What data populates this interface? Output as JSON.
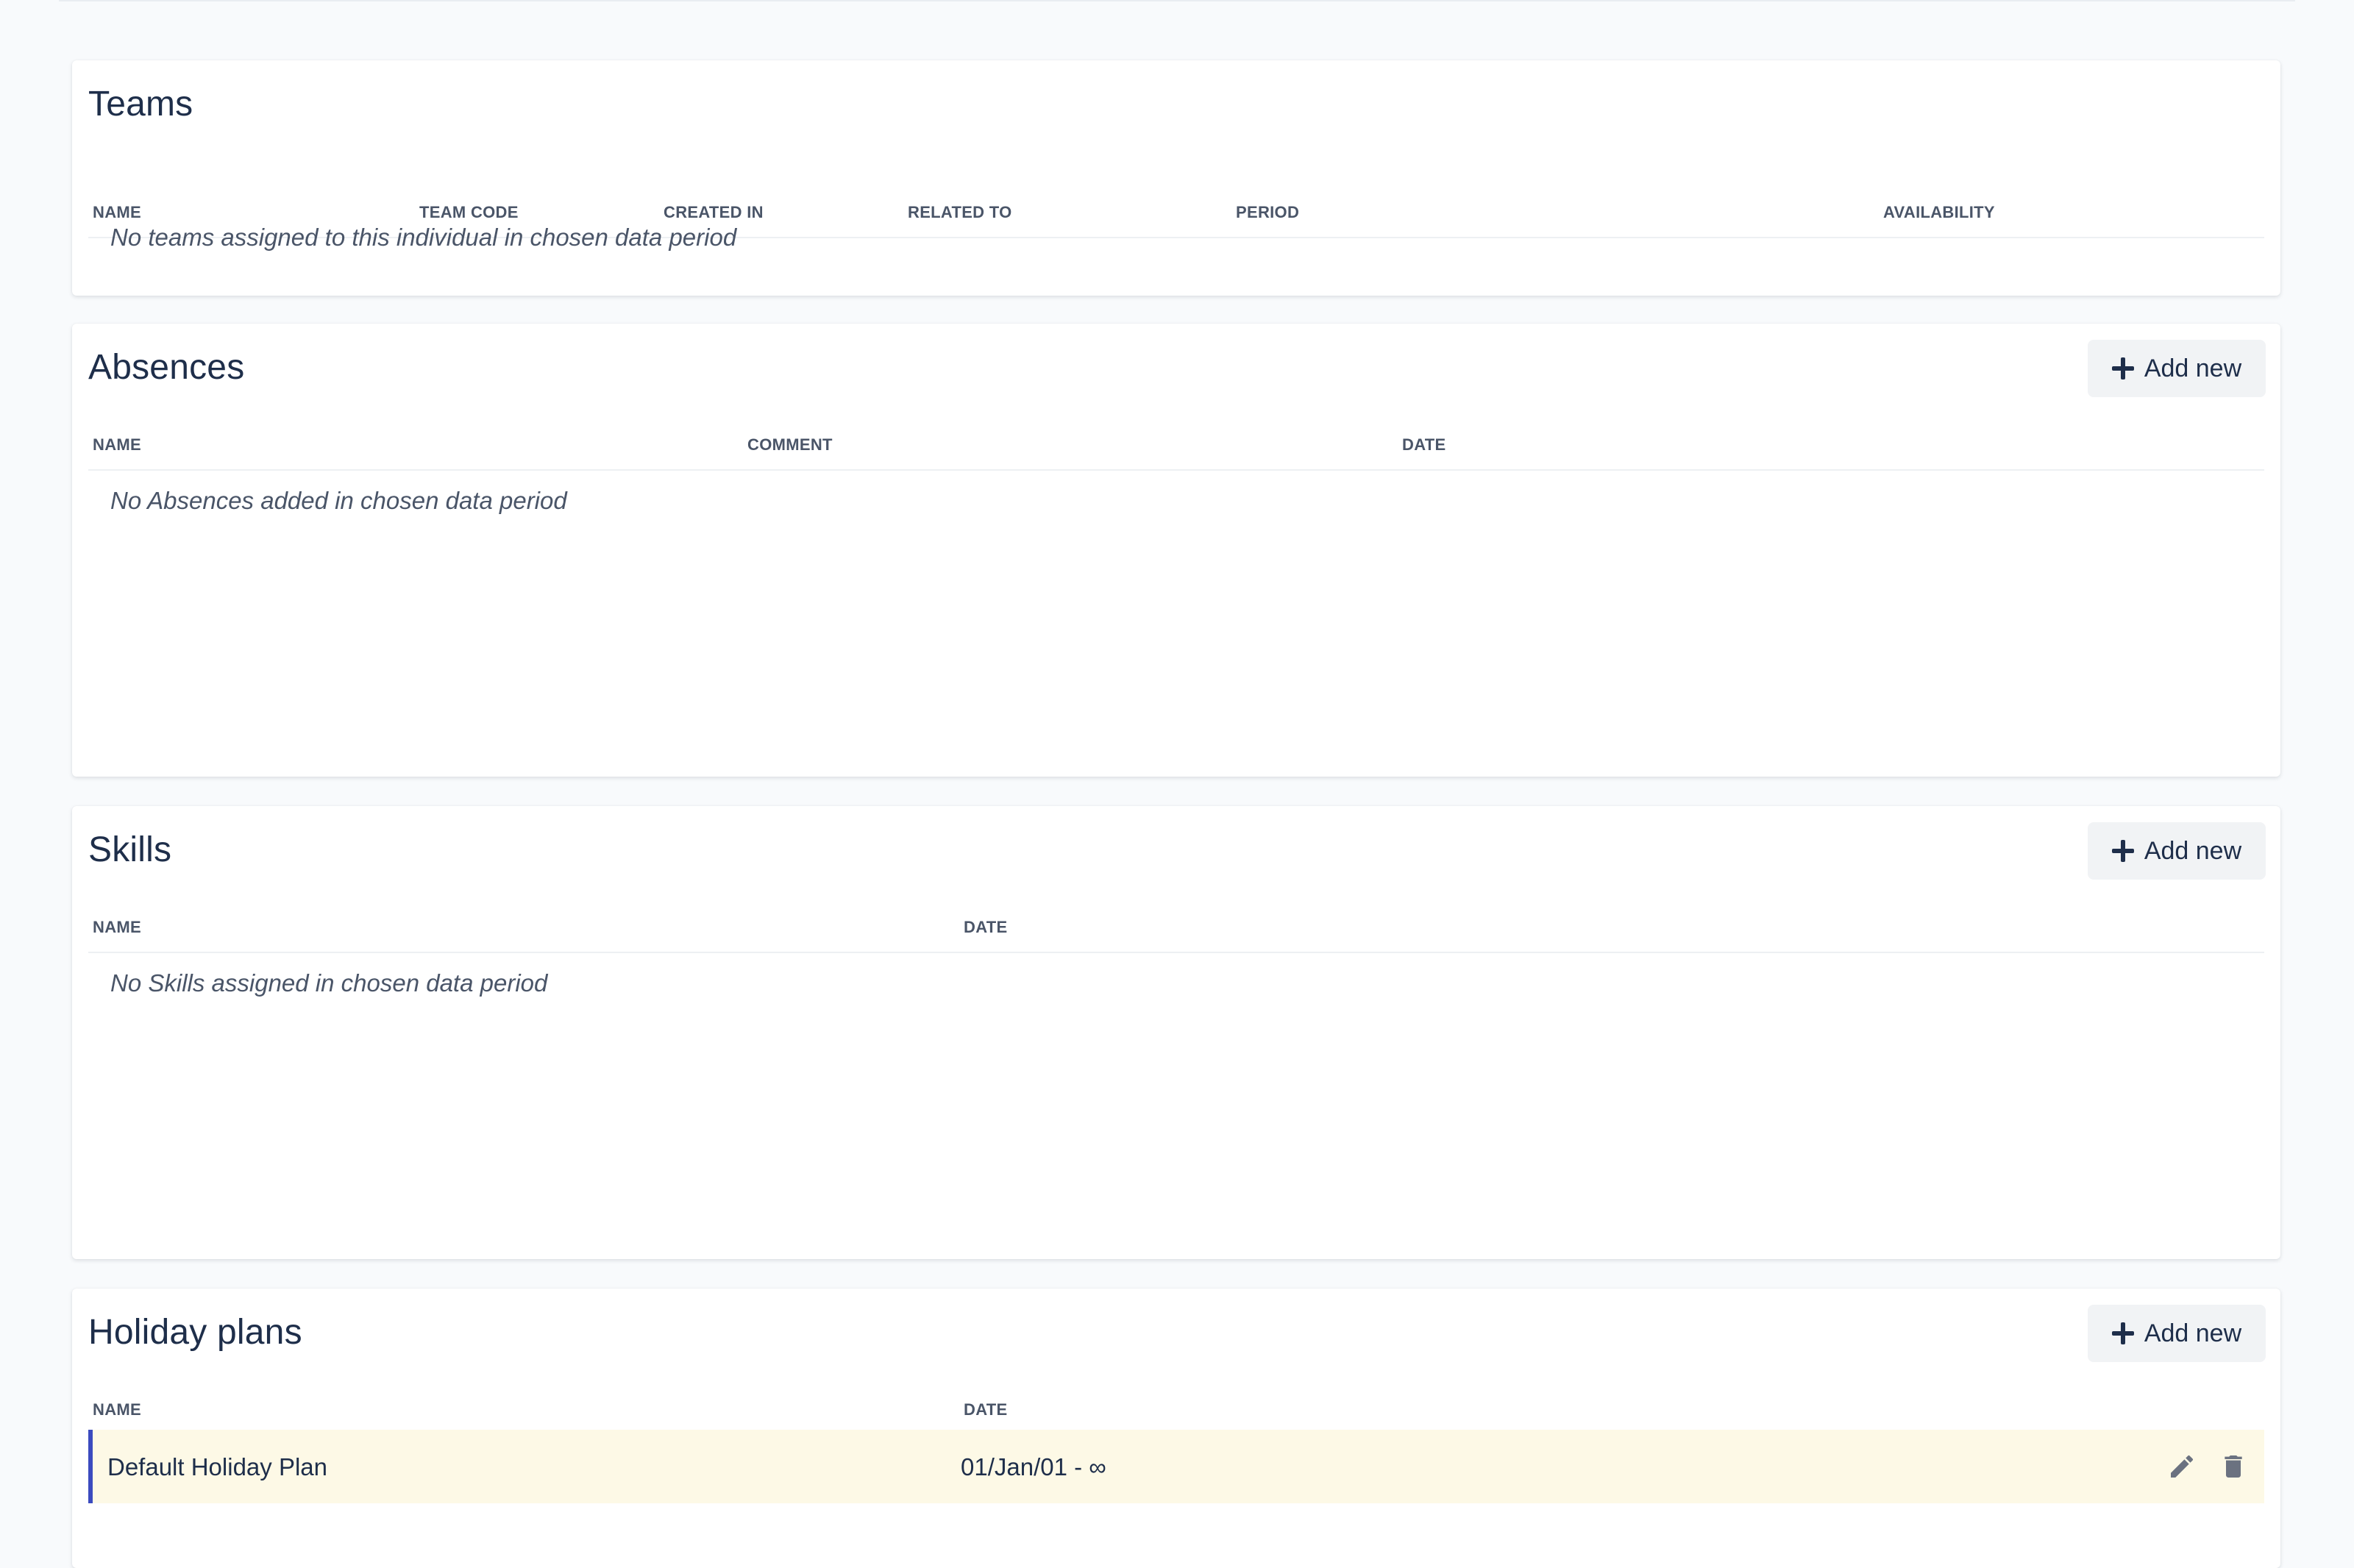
{
  "teams": {
    "title": "Teams",
    "columns": [
      "NAME",
      "TEAM CODE",
      "CREATED IN",
      "RELATED TO",
      "PERIOD",
      "AVAILABILITY"
    ],
    "empty_message": "No teams assigned to this individual in chosen data period"
  },
  "absences": {
    "title": "Absences",
    "add_label": "Add new",
    "columns": [
      "NAME",
      "COMMENT",
      "DATE"
    ],
    "empty_message": "No Absences added in chosen data period"
  },
  "skills": {
    "title": "Skills",
    "add_label": "Add new",
    "columns": [
      "NAME",
      "DATE"
    ],
    "empty_message": "No Skills assigned in chosen data period"
  },
  "holiday_plans": {
    "title": "Holiday plans",
    "add_label": "Add new",
    "columns": [
      "NAME",
      "DATE"
    ],
    "rows": [
      {
        "name": "Default Holiday Plan",
        "date": "01/Jan/01 - ∞"
      }
    ]
  },
  "icons": [
    "plus-icon",
    "edit-pencil-icon",
    "delete-trash-icon"
  ],
  "colors": {
    "row_highlight": "#fdf9e6",
    "row_accent": "#3b4bbf",
    "title": "#1e2e4a"
  }
}
